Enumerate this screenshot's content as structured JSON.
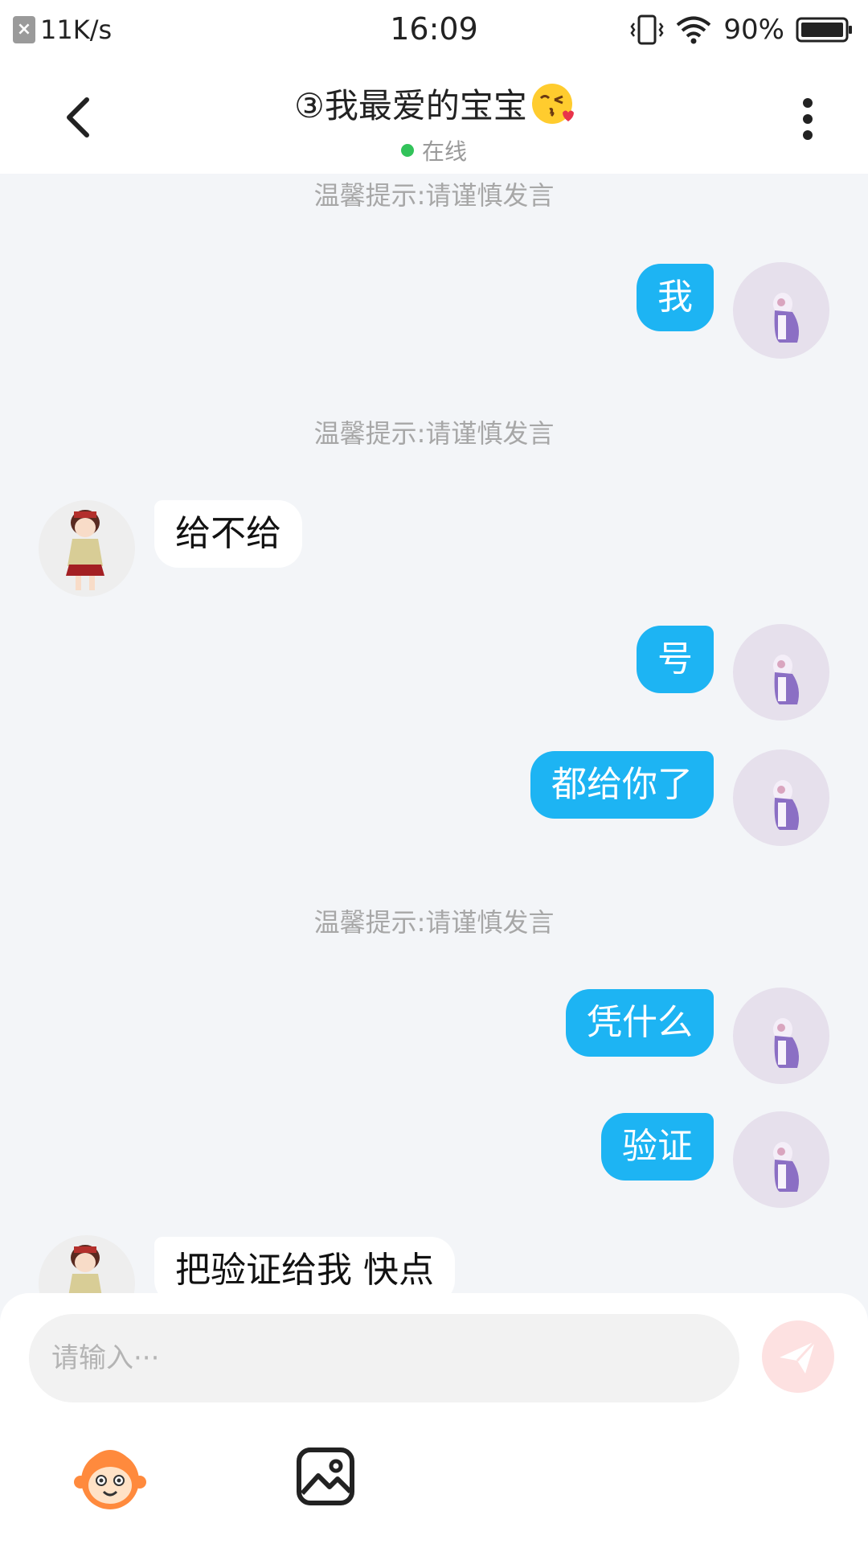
{
  "status_bar": {
    "net_speed": "11K/s",
    "time": "16:09",
    "battery_percent": "90%"
  },
  "header": {
    "title": "③我最爱的宝宝",
    "status": "在线"
  },
  "messages": {
    "tip_1": "温馨提示:请谨慎发言",
    "m1": "我",
    "tip_2": "温馨提示:请谨慎发言",
    "m2": "给不给",
    "m3": "号",
    "m4": "都给你了",
    "tip_3": "温馨提示:请谨慎发言",
    "m5": "凭什么",
    "m6": "验证",
    "m7": "把验证给我 快点"
  },
  "composer": {
    "placeholder": "请输入···",
    "value": ""
  },
  "colors": {
    "my_bubble": "#1db4f3",
    "their_bubble": "#ffffff",
    "background": "#f3f5f8",
    "online_dot": "#32c35a",
    "send_button": "#fde1e1"
  },
  "icons": {
    "back": "chevron-left-icon",
    "more": "more-vertical-icon",
    "send": "send-icon",
    "emoji": "monkey-emoji-icon",
    "image": "image-icon"
  }
}
